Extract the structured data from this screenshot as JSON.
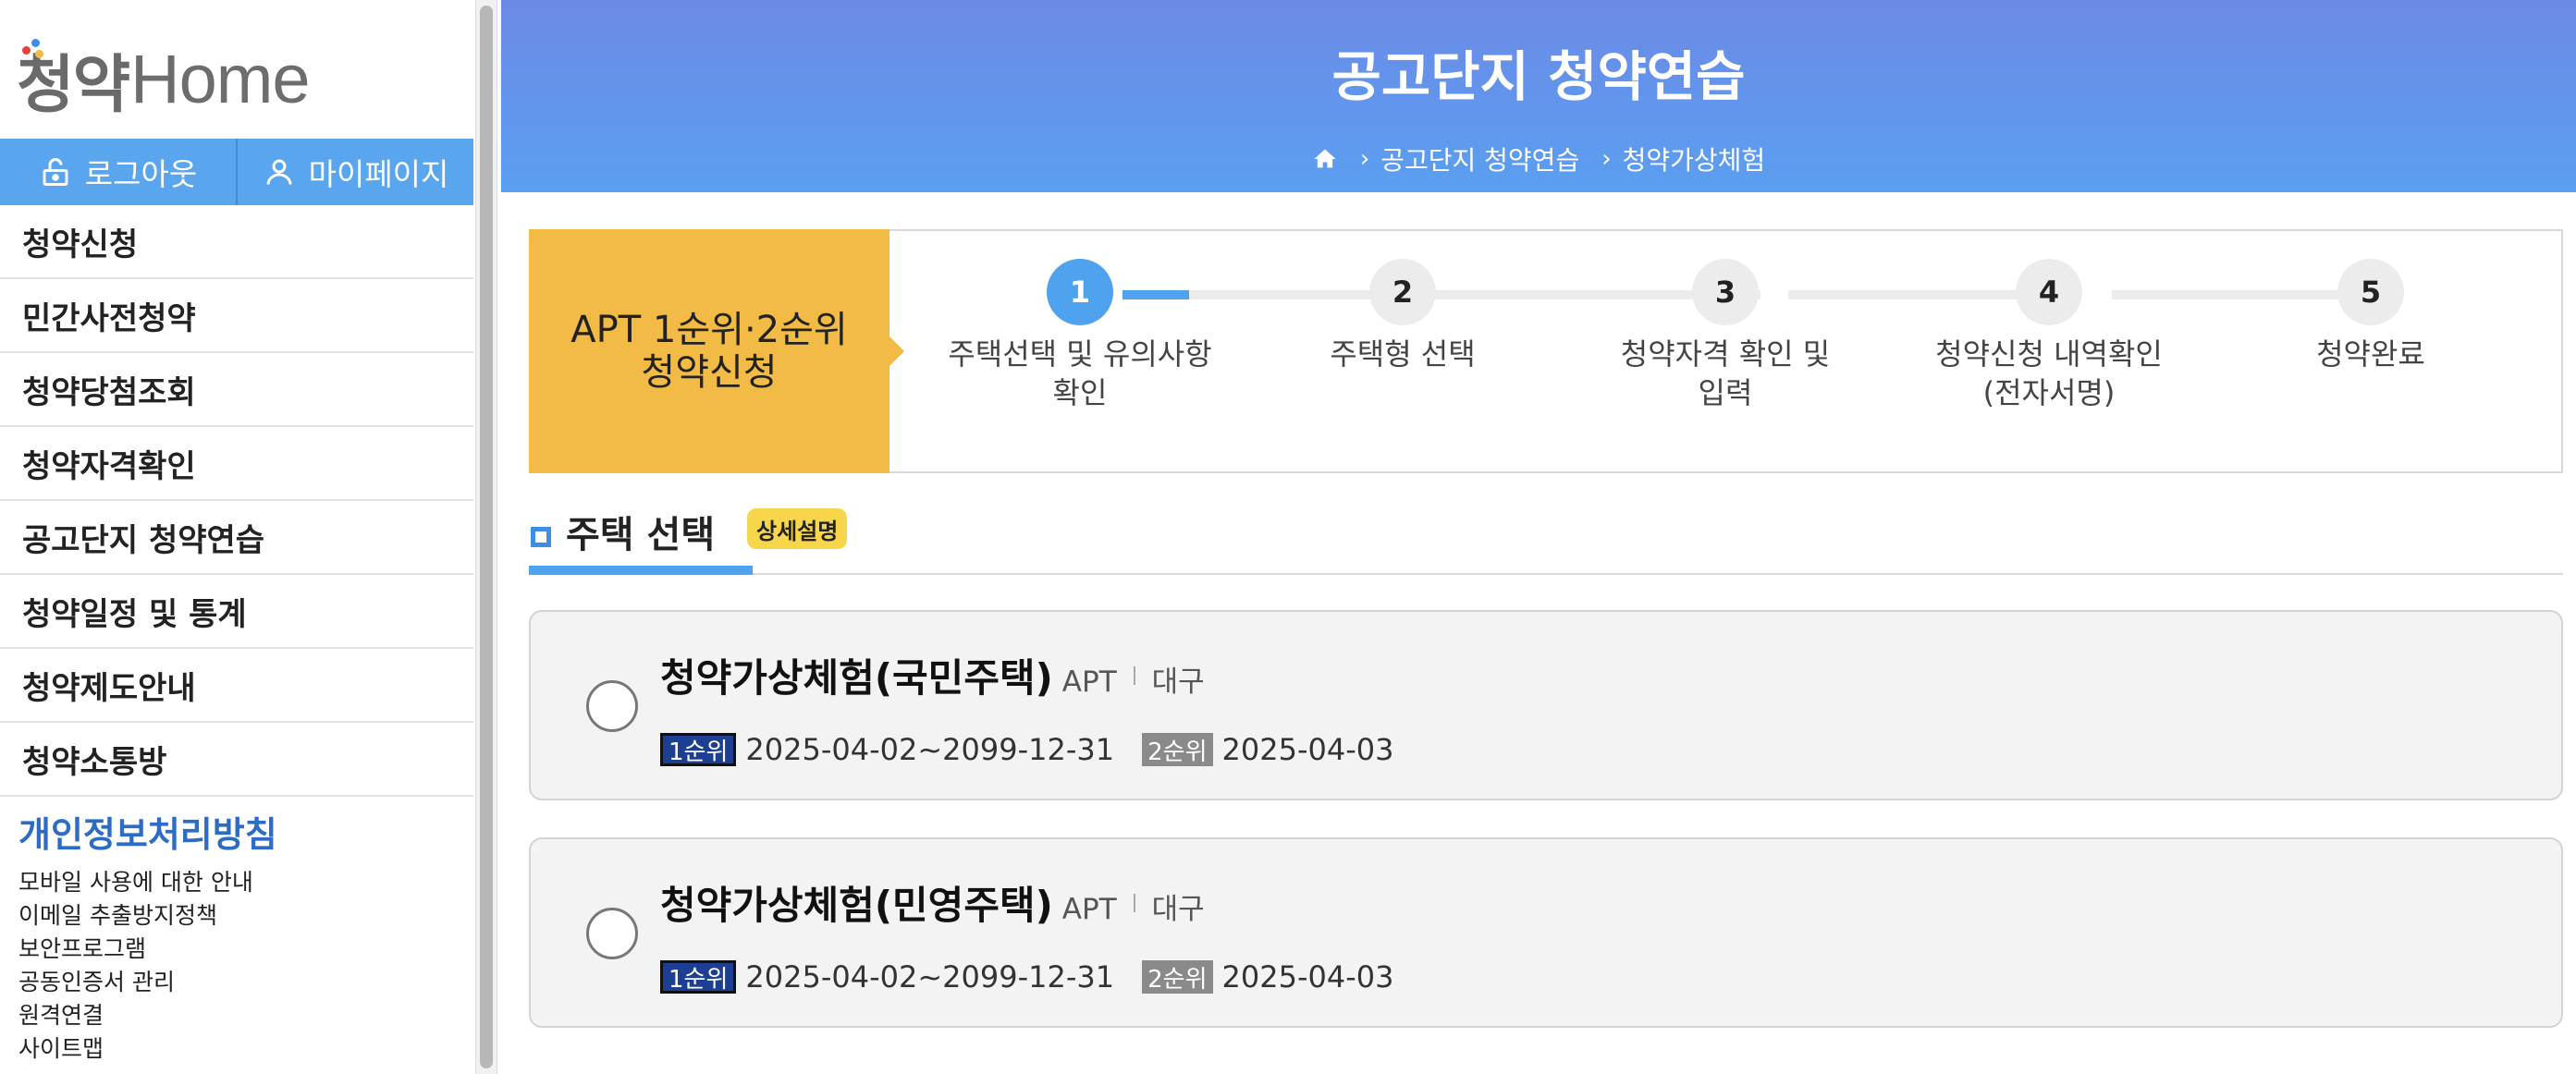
{
  "logo": {
    "chung": "청",
    "yak": "약",
    "home": "Home"
  },
  "auth": {
    "logout": "로그아웃",
    "mypage": "마이페이지"
  },
  "menu": [
    "청약신청",
    "민간사전청약",
    "청약당첨조회",
    "청약자격확인",
    "공고단지 청약연습",
    "청약일정 및 통계",
    "청약제도안내",
    "청약소통방"
  ],
  "policy": {
    "head": "개인정보처리방침",
    "links": [
      "모바일 사용에 대한 안내",
      "이메일 추출방지정책",
      "보안프로그램",
      "공동인증서 관리",
      "원격연결",
      "사이트맵"
    ]
  },
  "hero": {
    "title": "공고단지 청약연습",
    "breadcrumb": [
      "공고단지 청약연습",
      "청약가상체험"
    ]
  },
  "stepper": {
    "tag": [
      "APT 1순위·2순위",
      "청약신청"
    ],
    "current_step": 1,
    "steps": [
      {
        "num": "1",
        "label": [
          "주택선택 및 유의사항",
          "확인"
        ]
      },
      {
        "num": "2",
        "label": [
          "주택형 선택"
        ]
      },
      {
        "num": "3",
        "label": [
          "청약자격 확인 및",
          "입력"
        ]
      },
      {
        "num": "4",
        "label": [
          "청약신청 내역확인",
          "(전자서명)"
        ]
      },
      {
        "num": "5",
        "label": [
          "청약완료"
        ]
      }
    ]
  },
  "section": {
    "title": "주택 선택",
    "badge": "상세설명"
  },
  "houses": [
    {
      "name": "청약가상체험(국민주택)",
      "type": "APT",
      "region": "대구",
      "rank1_label": "1순위",
      "rank1_date": "2025-04-02~2099-12-31",
      "rank2_label": "2순위",
      "rank2_date": "2025-04-03"
    },
    {
      "name": "청약가상체험(민영주택)",
      "type": "APT",
      "region": "대구",
      "rank1_label": "1순위",
      "rank1_date": "2025-04-02~2099-12-31",
      "rank2_label": "2순위",
      "rank2_date": "2025-04-03"
    }
  ],
  "colors": {
    "primary": "#4fa3ee",
    "hero_top": "#6b8ae6",
    "hero_bottom": "#5a9ff0",
    "tag": "#f2bb45",
    "badge": "#f7d64b",
    "rank1": "#1c3f94",
    "rank2": "#8a8a8a",
    "policy": "#2c6cc4"
  }
}
